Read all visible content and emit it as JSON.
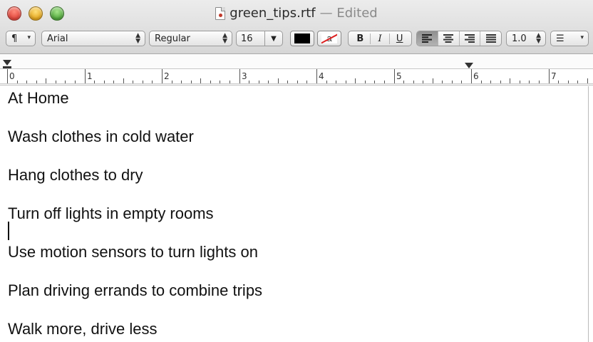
{
  "window": {
    "filename": "green_tips.rtf",
    "status": "— Edited"
  },
  "toolbar": {
    "paragraph_style": "¶",
    "font_family": "Arial",
    "font_style": "Regular",
    "font_size": "16",
    "text_color": "#000000",
    "background_color_label": "a",
    "bold": "B",
    "italic": "I",
    "underline": "U",
    "line_spacing": "1.0",
    "list_label": "☰"
  },
  "ruler": {
    "numbers": [
      "0",
      "1",
      "2",
      "3",
      "4",
      "5",
      "6",
      "7"
    ]
  },
  "document": {
    "lines": [
      "At Home",
      "Wash clothes in cold water",
      "Hang clothes to dry",
      "Turn off lights in empty rooms",
      "Use motion sensors to turn lights on",
      "Plan driving errands to combine trips",
      "Walk more, drive less"
    ]
  }
}
